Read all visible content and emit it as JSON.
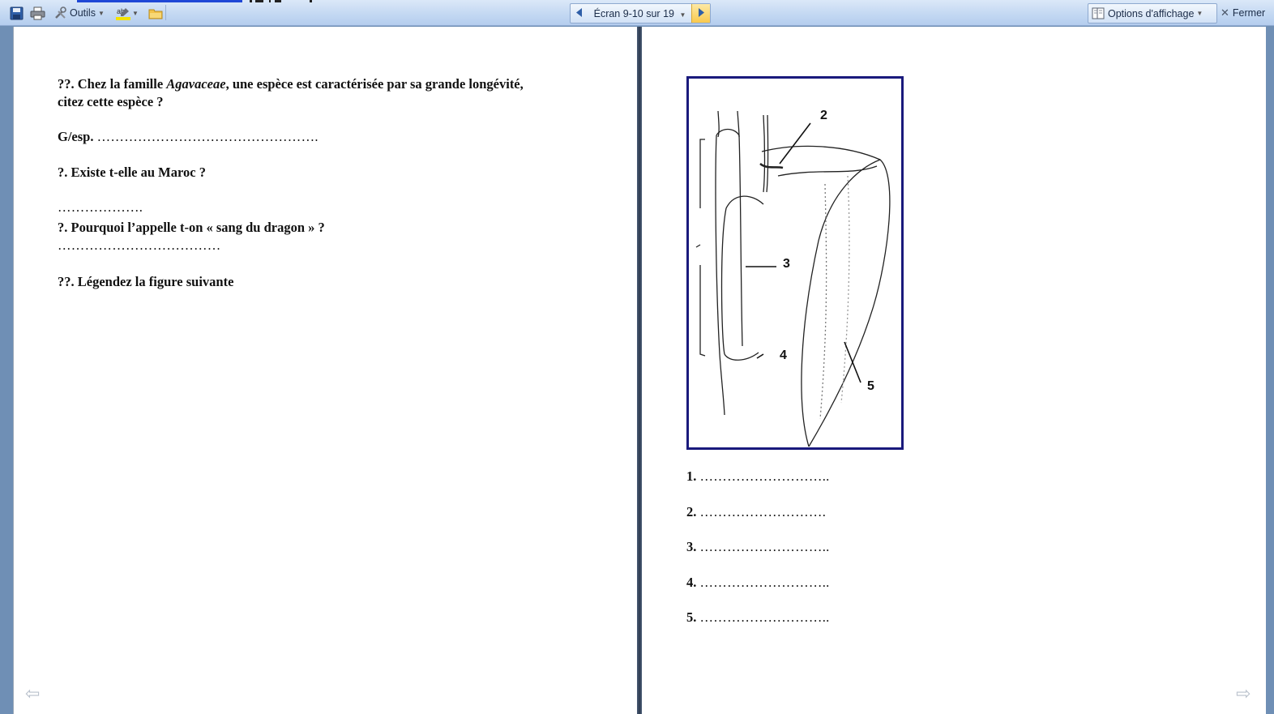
{
  "toolbar": {
    "tools_label": "Outils",
    "nav_label": "Écran 9-10 sur 19",
    "options_label": "Options d'affichage",
    "close_label": "Fermer"
  },
  "left_page": {
    "q1_prefix": "??. Chez la famille ",
    "q1_italic": "Agavaceae",
    "q1_suffix": ", une espèce est caractérisée par sa grande longévité,",
    "q1_line2": "citez cette espèce ?",
    "gesp_label": "G/esp.",
    "gesp_dots": "………………………………………….",
    "q2": "?. Existe t-elle au Maroc ?",
    "q2_dots": "……………….",
    "q3": "?. Pourquoi l’appelle t-on « sang du dragon » ?",
    "q3_dots": "………………………………",
    "q4": "??. Légendez la figure suivante"
  },
  "figure": {
    "labels": [
      "2",
      "3",
      "4",
      "5"
    ]
  },
  "legend": [
    {
      "num": "1.",
      "dots": "……………………….."
    },
    {
      "num": "2.",
      "dots": "………………………."
    },
    {
      "num": "3.",
      "dots": "……………………….."
    },
    {
      "num": "4.",
      "dots": "……………………….."
    },
    {
      "num": "5.",
      "dots": "……………………….."
    }
  ],
  "icons": [
    "save-icon",
    "print-icon",
    "tools-icon",
    "highlight-icon",
    "folder-icon",
    "prev-arrow-icon",
    "next-arrow-icon",
    "view-options-icon",
    "close-icon",
    "page-back-icon",
    "page-forward-icon"
  ],
  "colors": {
    "toolbar": "#c6daf3",
    "accent": "#f9c94c",
    "figure_border": "#1a1a7c"
  }
}
